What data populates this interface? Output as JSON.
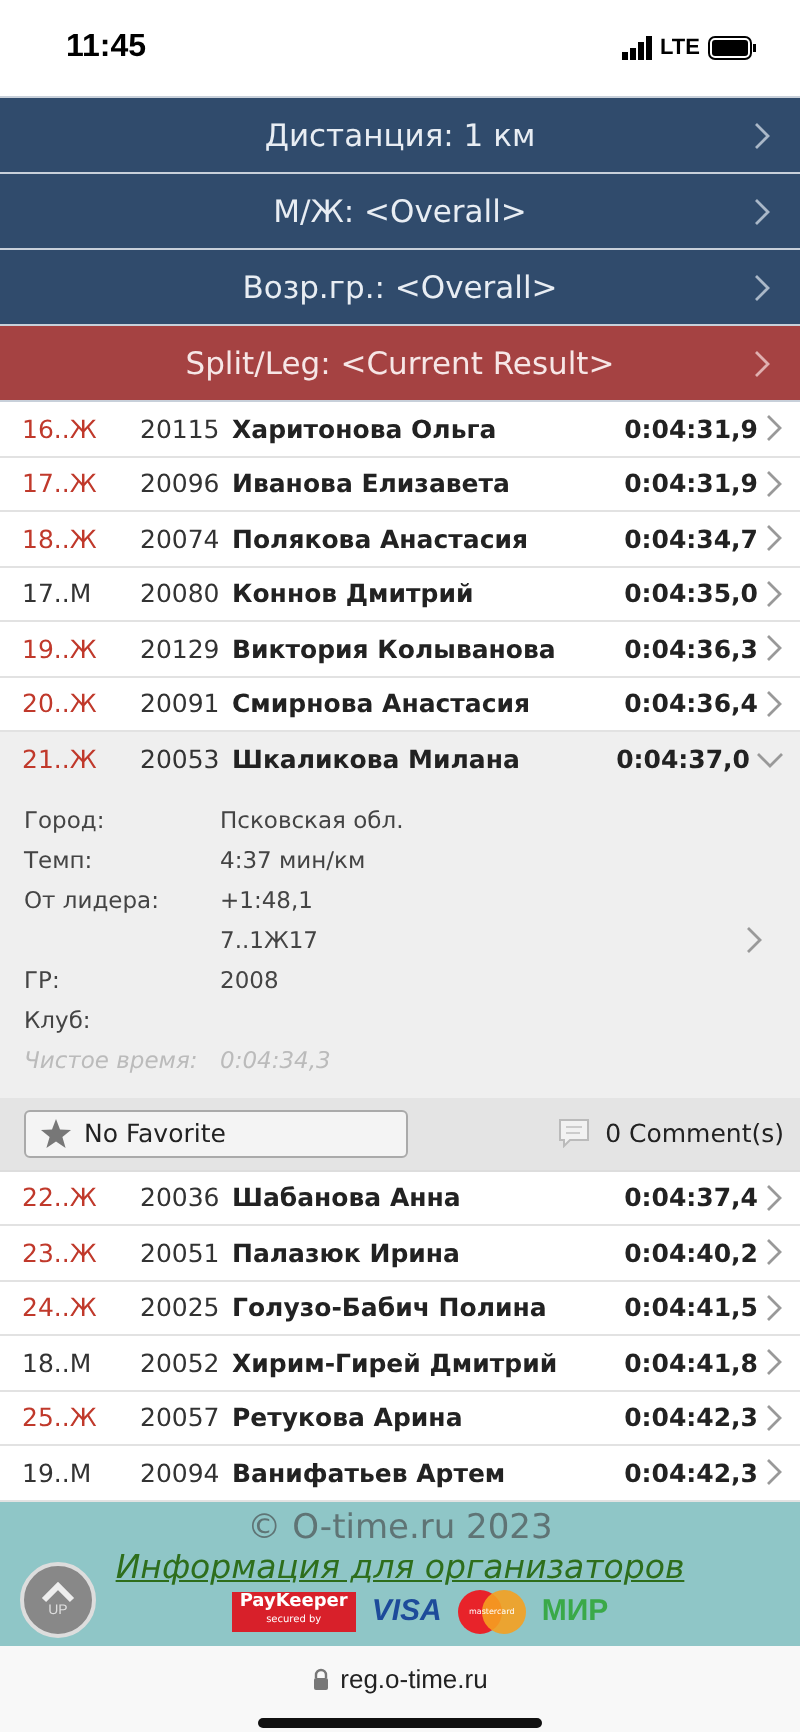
{
  "status_bar": {
    "time": "11:45",
    "network": "LTE"
  },
  "filters": [
    {
      "label": "Дистанция: 1 км",
      "selected": false
    },
    {
      "label": "М/Ж: <Overall>",
      "selected": false
    },
    {
      "label": "Возр.гр.: <Overall>",
      "selected": false
    },
    {
      "label": "Split/Leg: <Current Result>",
      "selected": true
    }
  ],
  "results": [
    {
      "rank": "16..Ж",
      "color": "#c0392b",
      "bib": "20115",
      "name": "Харитонова Ольга",
      "time": "0:04:31,9",
      "expanded": false
    },
    {
      "rank": "17..Ж",
      "color": "#c0392b",
      "bib": "20096",
      "name": "Иванова Елизавета",
      "time": "0:04:31,9",
      "expanded": false
    },
    {
      "rank": "18..Ж",
      "color": "#c0392b",
      "bib": "20074",
      "name": "Полякова Анастасия",
      "time": "0:04:34,7",
      "expanded": false
    },
    {
      "rank": "17..М",
      "color": "#333333",
      "bib": "20080",
      "name": "Коннов Дмитрий",
      "time": "0:04:35,0",
      "expanded": false
    },
    {
      "rank": "19..Ж",
      "color": "#c0392b",
      "bib": "20129",
      "name": "Виктория Колыванова",
      "time": "0:04:36,3",
      "expanded": false
    },
    {
      "rank": "20..Ж",
      "color": "#c0392b",
      "bib": "20091",
      "name": "Смирнова Анастасия",
      "time": "0:04:36,4",
      "expanded": false
    },
    {
      "rank": "21..Ж",
      "color": "#c0392b",
      "bib": "20053",
      "name": "Шкаликова Милана",
      "time": "0:04:37,0",
      "expanded": true,
      "details": {
        "fields": [
          {
            "label": "Город:",
            "value": "Псковская обл.",
            "kind": "normal"
          },
          {
            "label": "Темп:",
            "value": "4:37 мин/км",
            "kind": "normal"
          },
          {
            "label": "От лидера:",
            "value": "+1:48,1",
            "kind": "normal"
          },
          {
            "value": "7..1Ж17",
            "kind": "normal"
          },
          {
            "label": "ГР:",
            "value": "2008",
            "kind": "normal"
          },
          {
            "label": "Клуб:",
            "kind": "normal"
          },
          {
            "label": "Чистое время:",
            "value": "0:04:34,3",
            "kind": "muted"
          }
        ],
        "favorite": {
          "label": "No Favorite",
          "on": false
        },
        "comments": "0 Comment(s)"
      }
    },
    {
      "rank": "22..Ж",
      "color": "#c0392b",
      "bib": "20036",
      "name": "Шабанова Анна",
      "time": "0:04:37,4",
      "expanded": false
    },
    {
      "rank": "23..Ж",
      "color": "#c0392b",
      "bib": "20051",
      "name": "Палазюк Ирина",
      "time": "0:04:40,2",
      "expanded": false
    },
    {
      "rank": "24..Ж",
      "color": "#c0392b",
      "bib": "20025",
      "name": "Голузо-Бабич Полина",
      "time": "0:04:41,5",
      "expanded": false
    },
    {
      "rank": "18..М",
      "color": "#333333",
      "bib": "20052",
      "name": "Хирим-Гирей Дмитрий",
      "time": "0:04:41,8",
      "expanded": false
    },
    {
      "rank": "25..Ж",
      "color": "#c0392b",
      "bib": "20057",
      "name": "Ретукова Арина",
      "time": "0:04:42,3",
      "expanded": false
    },
    {
      "rank": "19..М",
      "color": "#333333",
      "bib": "20094",
      "name": "Ванифатьев Артем",
      "time": "0:04:42,3",
      "expanded": false
    }
  ],
  "footer": {
    "copyright": "© O-time.ru 2023",
    "link": "Информация для организаторов",
    "up_button": "UP",
    "payments": [
      {
        "kind": "paykeeper",
        "label": "PayKeeper",
        "sub": "secured by"
      },
      {
        "kind": "visa",
        "label": "VISA"
      },
      {
        "kind": "mastercard",
        "label": "mastercard"
      },
      {
        "kind": "mir",
        "label": "МИР"
      }
    ]
  },
  "browser": {
    "url": "reg.o-time.ru"
  }
}
